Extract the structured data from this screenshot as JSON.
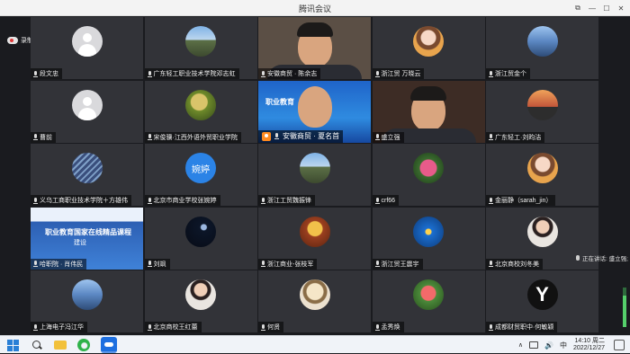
{
  "window": {
    "title": "腾讯会议",
    "controls": [
      {
        "name": "pin-icon",
        "glyph": "⧉"
      },
      {
        "name": "minimize-icon",
        "glyph": "—"
      },
      {
        "name": "maximize-icon",
        "glyph": "☐"
      },
      {
        "name": "close-icon",
        "glyph": "✕"
      }
    ]
  },
  "recording": {
    "label": "录制中"
  },
  "participants": [
    {
      "name": "段文忠",
      "avatar": "blank"
    },
    {
      "name": "广东轻工职业技术学院邓志虹",
      "avatar": "mountain"
    },
    {
      "name": "安徽商贸 · 陈余志",
      "avatar": "video"
    },
    {
      "name": "浙江贸 万晓云",
      "avatar": "girl"
    },
    {
      "name": "浙江贸金个",
      "avatar": "sea"
    },
    {
      "name": "曹前",
      "avatar": "blank"
    },
    {
      "name": "宋俊骥·江西外语外贸职业学院",
      "avatar": "grass"
    },
    {
      "name": "安徽商贸 · 夏名首",
      "avatar": "slide-speaker"
    },
    {
      "name": "盛立强",
      "avatar": "video2"
    },
    {
      "name": "广东轻工·刘昀洁",
      "avatar": "sunset"
    },
    {
      "name": "义乌工商职业技术学院＋方雄伟",
      "avatar": "solar"
    },
    {
      "name": "北京市商业学校张婉婷",
      "avatar": "text",
      "avatar_text": "婉婷"
    },
    {
      "name": "浙江工贸魏振锋",
      "avatar": "mountain"
    },
    {
      "name": "crf66",
      "avatar": "flower"
    },
    {
      "name": "金丽静（sarah_jin）",
      "avatar": "girl"
    },
    {
      "name": "哈职院 · 肖伟民",
      "avatar": "slide"
    },
    {
      "name": "刘飒",
      "avatar": "night"
    },
    {
      "name": "浙江商业-张枝军",
      "avatar": "orange"
    },
    {
      "name": "浙江贸王震宇",
      "avatar": "blue"
    },
    {
      "name": "北京商校刘冬美",
      "avatar": "person"
    },
    {
      "name": "上海电子冯江华",
      "avatar": "sea"
    },
    {
      "name": "北京商校王红蕾",
      "avatar": "person"
    },
    {
      "name": "何贤",
      "avatar": "drawing"
    },
    {
      "name": "孟秀焕",
      "avatar": "tulip"
    },
    {
      "name": "成都财贸职中·何敏颖",
      "avatar": "icon-black"
    }
  ],
  "slides": {
    "speaker_slide_text": "职业教育",
    "course_slide_title": "职业教育国家在线精品课程",
    "course_slide_subtitle": "建设"
  },
  "speaking": {
    "label": "正在讲话: 盛立强;"
  },
  "volume": {
    "level": 0.8
  },
  "taskbar": {
    "tray_ime": "中",
    "time": "14:10 周二",
    "date": "2022/12/27"
  }
}
